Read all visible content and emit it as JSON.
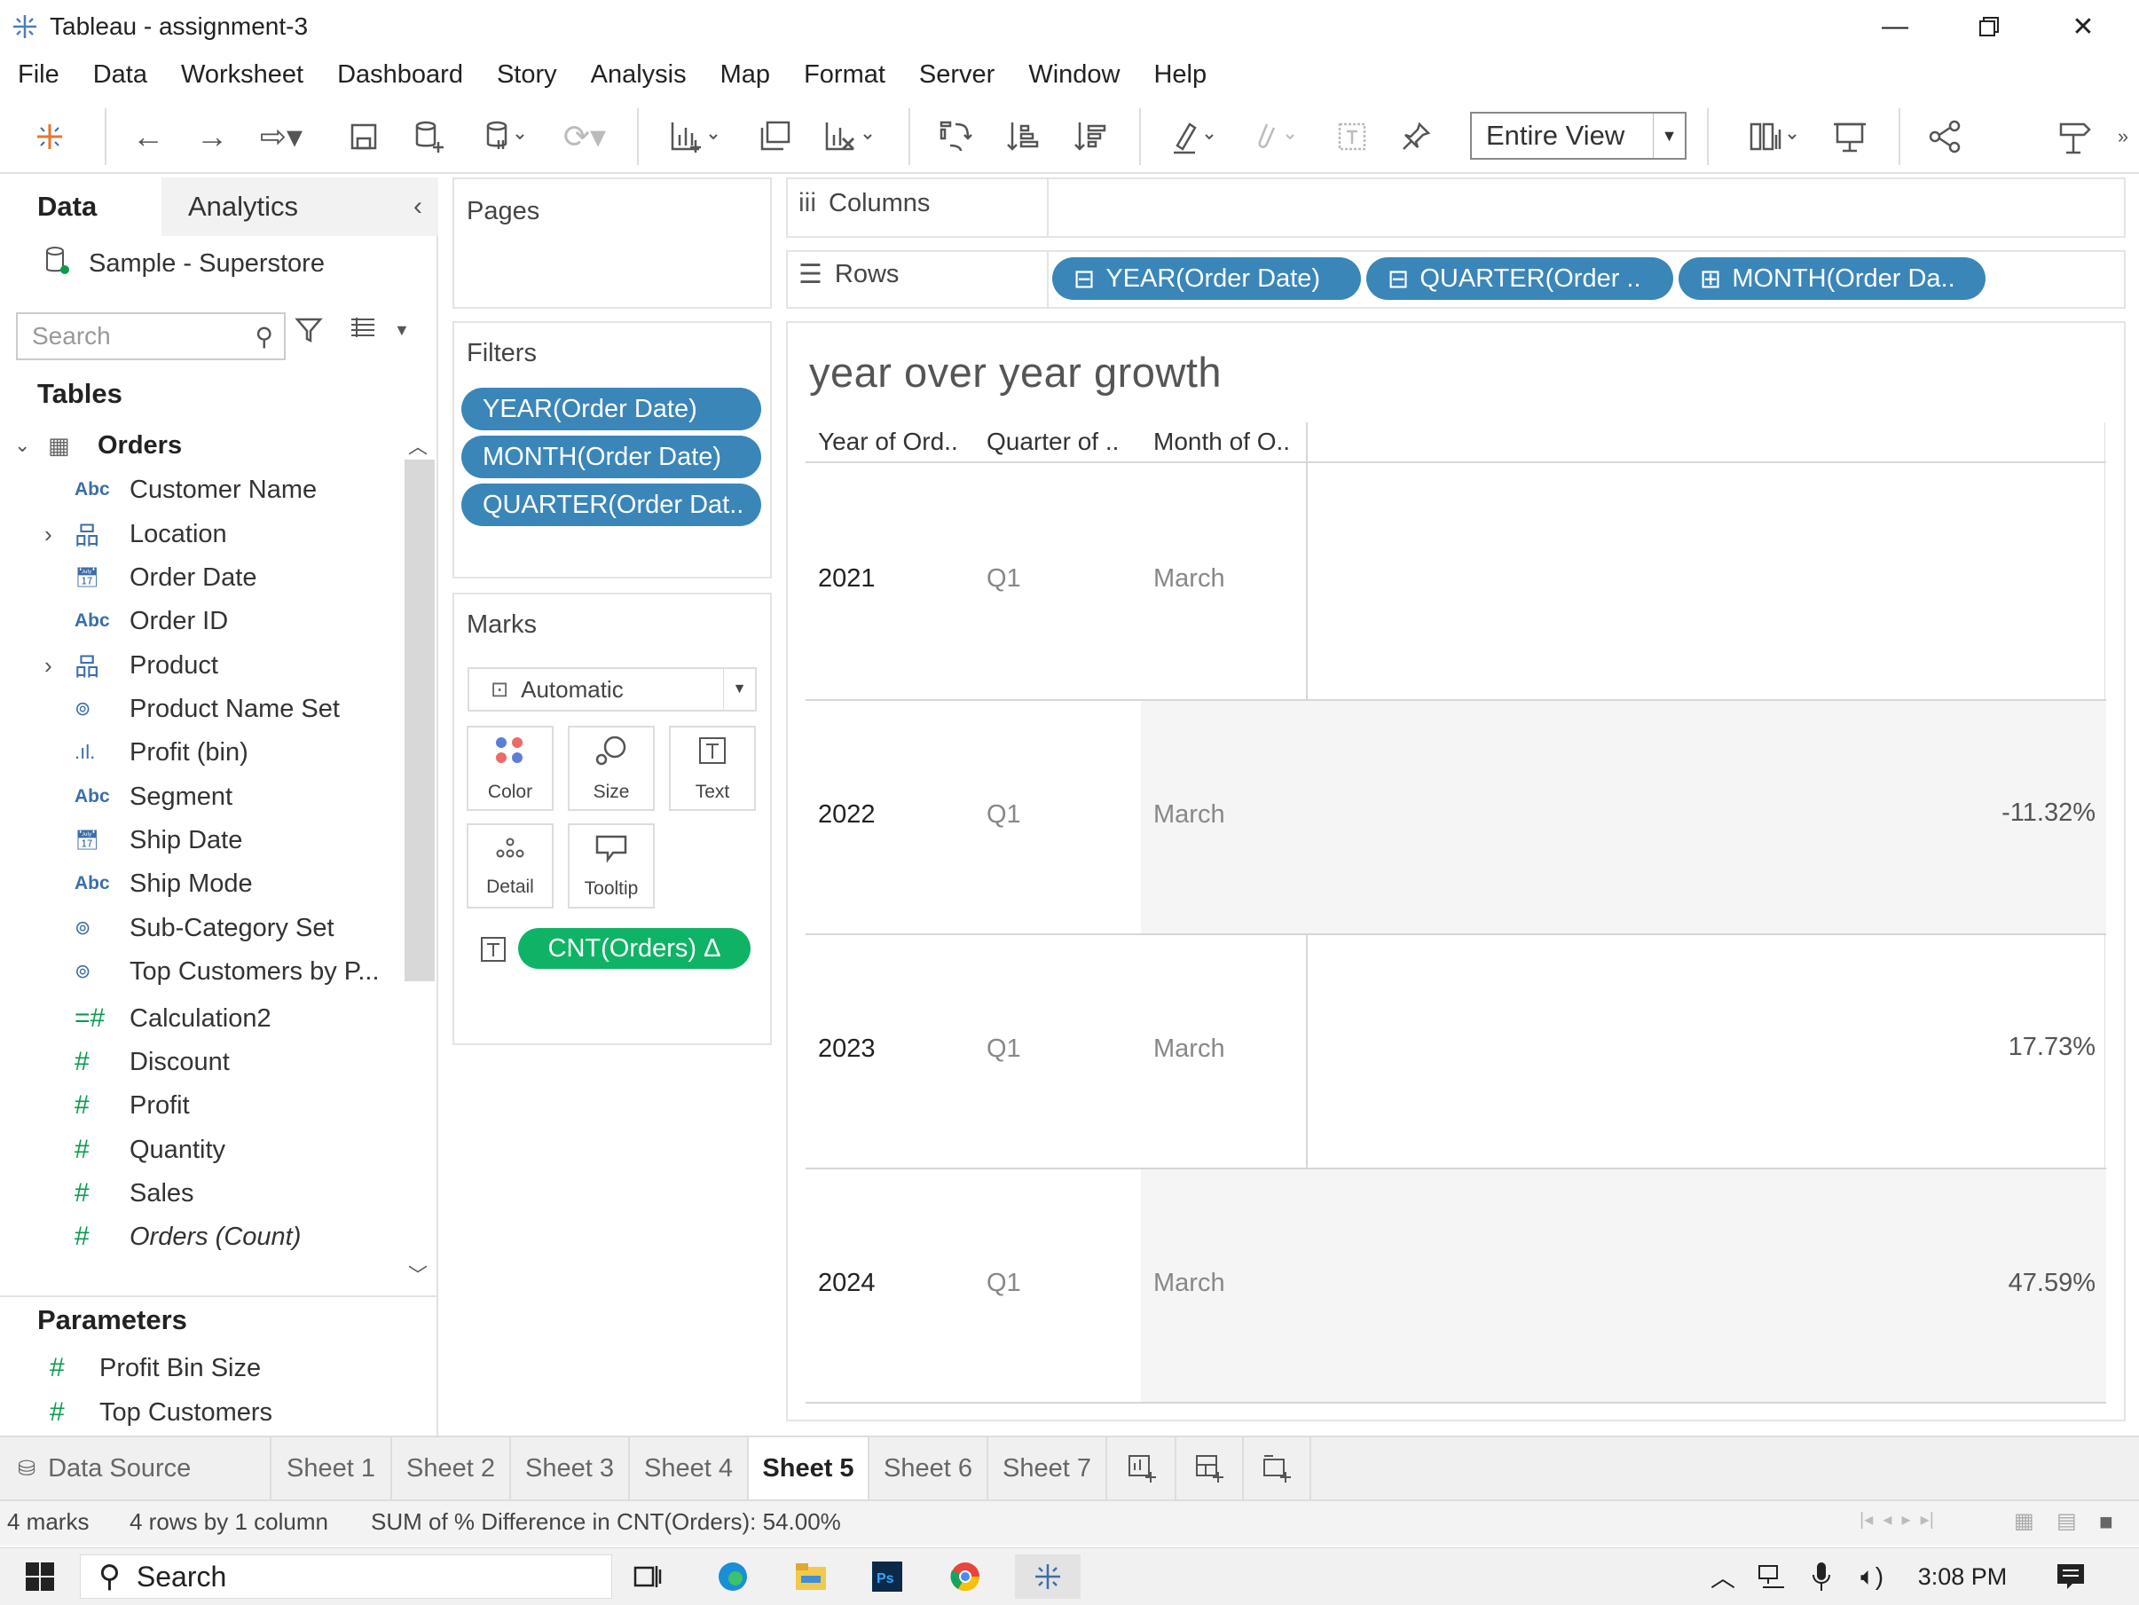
{
  "window": {
    "title": "Tableau - assignment-3"
  },
  "menu": [
    "File",
    "Data",
    "Worksheet",
    "Dashboard",
    "Story",
    "Analysis",
    "Map",
    "Format",
    "Server",
    "Window",
    "Help"
  ],
  "toolbar": {
    "view_mode": "Entire View"
  },
  "left_pane": {
    "tab_data": "Data",
    "tab_analytics": "Analytics",
    "data_source": "Sample - Superstore",
    "search_placeholder": "Search",
    "tables_heading": "Tables",
    "table_name": "Orders",
    "fields": [
      {
        "label": "Customer Name",
        "icon": "Abc"
      },
      {
        "label": "Location",
        "icon": "hierarchy"
      },
      {
        "label": "Order Date",
        "icon": "calendar"
      },
      {
        "label": "Order ID",
        "icon": "Abc"
      },
      {
        "label": "Product",
        "icon": "hierarchy"
      },
      {
        "label": "Product Name Set",
        "icon": "set"
      },
      {
        "label": "Profit (bin)",
        "icon": "bin"
      },
      {
        "label": "Segment",
        "icon": "Abc"
      },
      {
        "label": "Ship Date",
        "icon": "calendar"
      },
      {
        "label": "Ship Mode",
        "icon": "Abc"
      },
      {
        "label": "Sub-Category Set",
        "icon": "set"
      },
      {
        "label": "Top Customers by P...",
        "icon": "set"
      },
      {
        "label": "Calculation2",
        "icon": "calc-measure"
      },
      {
        "label": "Discount",
        "icon": "measure"
      },
      {
        "label": "Profit",
        "icon": "measure"
      },
      {
        "label": "Quantity",
        "icon": "measure"
      },
      {
        "label": "Sales",
        "icon": "measure"
      },
      {
        "label": "Orders (Count)",
        "icon": "measure"
      }
    ],
    "parameters_heading": "Parameters",
    "parameters": [
      "Profit Bin Size",
      "Top Customers"
    ]
  },
  "cards": {
    "pages": "Pages",
    "filters": "Filters",
    "filter_pills": [
      "YEAR(Order Date)",
      "MONTH(Order Date)",
      "QUARTER(Order Dat.."
    ],
    "marks": "Marks",
    "mark_type": "Automatic",
    "mark_buttons": [
      "Color",
      "Size",
      "Text",
      "Detail",
      "Tooltip"
    ],
    "text_pill": "CNT(Orders) Δ"
  },
  "shelves": {
    "columns_label": "Columns",
    "rows_label": "Rows",
    "row_pills": [
      "YEAR(Order Date)",
      "QUARTER(Order ..",
      "MONTH(Order Da.."
    ]
  },
  "view": {
    "title": "year over year growth",
    "headers": [
      "Year of Ord..",
      "Quarter of ..",
      "Month of O.."
    ],
    "rows": [
      {
        "year": "2021",
        "quarter": "Q1",
        "month": "March",
        "value": ""
      },
      {
        "year": "2022",
        "quarter": "Q1",
        "month": "March",
        "value": "-11.32%"
      },
      {
        "year": "2023",
        "quarter": "Q1",
        "month": "March",
        "value": "17.73%"
      },
      {
        "year": "2024",
        "quarter": "Q1",
        "month": "March",
        "value": "47.59%"
      }
    ]
  },
  "sheets": {
    "data_source_tab": "Data Source",
    "tabs": [
      "Sheet 1",
      "Sheet 2",
      "Sheet 3",
      "Sheet 4",
      "Sheet 5",
      "Sheet 6",
      "Sheet 7"
    ],
    "active": "Sheet 5"
  },
  "status": {
    "marks": "4 marks",
    "dims": "4 rows by 1 column",
    "summary": "SUM of % Difference in CNT(Orders): 54.00%"
  },
  "taskbar": {
    "search": "Search",
    "time": "3:08 PM"
  }
}
